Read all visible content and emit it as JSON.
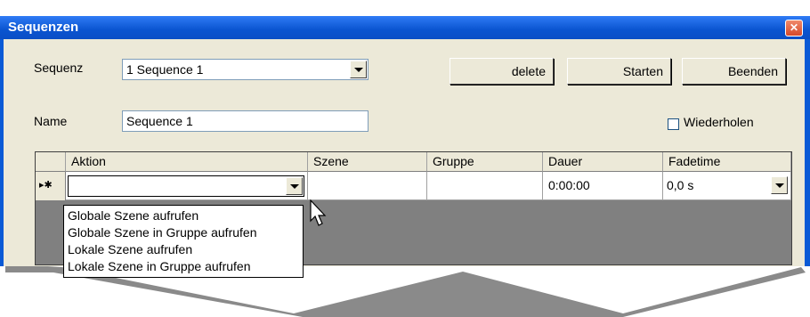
{
  "window": {
    "title": "Sequenzen",
    "close_glyph": "✕"
  },
  "sequence": {
    "label": "Sequenz",
    "value": "1 Sequence 1"
  },
  "buttons": {
    "delete": "delete",
    "start": "Starten",
    "end": "Beenden"
  },
  "name": {
    "label": "Name",
    "value": "Sequence 1"
  },
  "repeat": {
    "label": "Wiederholen",
    "checked": false
  },
  "grid": {
    "columns": [
      "Aktion",
      "Szene",
      "Gruppe",
      "Dauer",
      "Fadetime"
    ],
    "row_marker": "▸✱",
    "new_row": {
      "aktion": "",
      "szene": "",
      "gruppe": "",
      "dauer": "0:00:00",
      "fadetime": "0,0 s"
    }
  },
  "aktion_options": [
    "Globale Szene aufrufen",
    "Globale Szene in Gruppe aufrufen",
    "Lokale Szene aufrufen",
    "Lokale Szene in Gruppe aufrufen"
  ]
}
